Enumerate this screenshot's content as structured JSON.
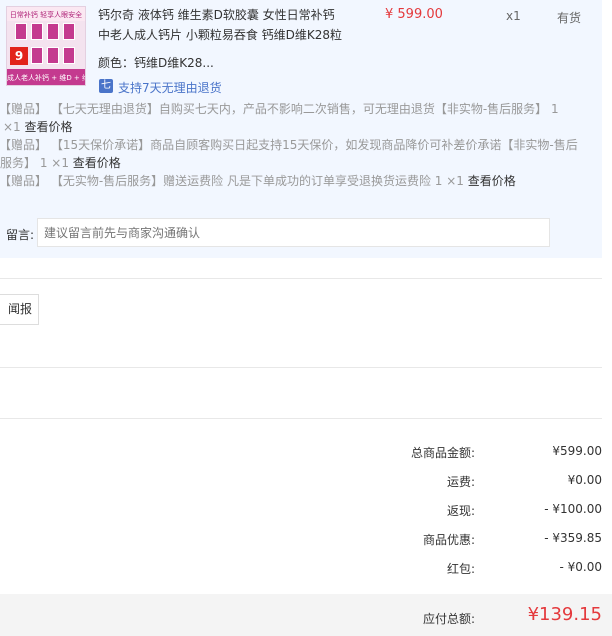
{
  "product": {
    "title_line1": "钙尔奇 液体钙 维生素D软胶囊 女性日常补钙",
    "title_line2": "中老人成人钙片 小颗粒易吞食 钙维D维K28粒",
    "price": "¥ 599.00",
    "quantity": "x1",
    "stock": "有货",
    "color_label": "颜色：",
    "color_value": "钙维D维K28...",
    "return_policy": "支持7天无理由退货",
    "thumb": {
      "top_text": "日常补钙 轻享人眼安全",
      "badge": "9",
      "bottom_text": "成人老人补钙 + 维D + 维K"
    }
  },
  "gifts": [
    {
      "line1": "【赠品】 【七天无理由退货】自购买七天内，产品不影响二次销售，可无理由退货【非实物-售后服务】 1",
      "line2_prefix": "×1",
      "link": "查看价格"
    },
    {
      "line1": "【赠品】 【15天保价承诺】商品自顾客购买日起支持15天保价，如发现商品降价可补差价承诺【非实物-售后",
      "line2_prefix": "服务】 1 ×1",
      "link": "查看价格"
    },
    {
      "line1_prefix": "【赠品】 【无实物-售后服务】赠送运费险 凡是下单成功的订单享受退换货运费险 1 ×1",
      "link": "查看价格"
    }
  ],
  "message": {
    "label": "留言:",
    "placeholder": "建议留言前先与商家沟通确认"
  },
  "invoice_button_label": "闻报销",
  "summary": [
    {
      "label": "总商品金额:",
      "value": "¥599.00"
    },
    {
      "label": "运费:",
      "value": "¥0.00"
    },
    {
      "label": "返现:",
      "value": "- ¥100.00"
    },
    {
      "label": "商品优惠:",
      "value": "- ¥359.85"
    },
    {
      "label": "红包:",
      "value": "- ¥0.00"
    }
  ],
  "total": {
    "label": "应付总额:",
    "value": "¥139.15"
  },
  "colors": {
    "price_red": "#e4393c",
    "link_blue": "#4a74c9",
    "order_bg": "#f2f7ff"
  }
}
